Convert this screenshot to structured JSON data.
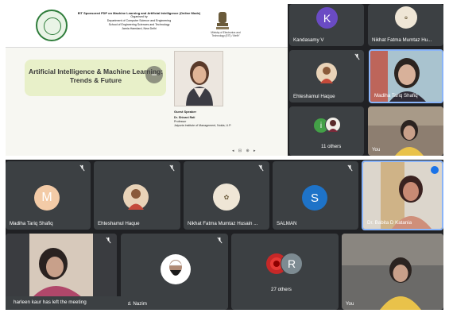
{
  "top_screenshot": {
    "slide": {
      "header_lines": [
        "EIT Sponsored FDP on Machine Learning and Artificial Intelligence (Online Mode)",
        "Organised by",
        "Department of Computer Science and Engineering",
        "School of Engineering Sciences and Technology",
        "Jamia Hamdard, New Delhi"
      ],
      "emblem_caption": "Ministry of Electronics and Technology (EIT) / MeitY",
      "title": "Artificial Intelligence & Machine Learning: Trends & Future",
      "speaker": {
        "heading": "Guest Speaker",
        "name": "Dr. Shivani Rati",
        "role": "Professor",
        "institute": "Jaipuria Institute of Management, Noida, U.P."
      },
      "controls": "◂ ⊟ ⊕ ▸"
    },
    "tiles": [
      {
        "name": "Kandasamy V",
        "initial": "K",
        "avatar_color": "#6a4bc4"
      },
      {
        "name": "Nikhat Fatma Mumtaz Hu...",
        "avatar_color": "#efe6d6"
      },
      {
        "name": "Ehteshamul Haque",
        "avatar_color": "#e9d3b8"
      },
      {
        "name": "Madiha Tariq Shafiq",
        "avatar_color": "#a2c6d6"
      },
      {
        "name": "11 others",
        "initial": "i",
        "avatar_color": "#43a047"
      },
      {
        "name": "You",
        "avatar_color": "#8a7b6a"
      }
    ]
  },
  "bottom_screenshot": {
    "tiles": [
      {
        "name": "Madiha Tariq Shafiq",
        "initial": "M",
        "avatar_color": "#f3cba7"
      },
      {
        "name": "Ehteshamul Haque",
        "avatar_color": "#e9d3b8"
      },
      {
        "name": "Nikhat Fatma Mumtaz Husain ...",
        "avatar_color": "#efe6d6"
      },
      {
        "name": "SALMAN",
        "initial": "S",
        "avatar_color": "#1e73c8"
      },
      {
        "name": "Dr. Babita D Katania",
        "avatar_color": "#c48a74"
      },
      {
        "name": "harleen kaur",
        "avatar_color": "#d9c8bb"
      },
      {
        "name": "hd. Nazim",
        "avatar_color": "#ffffff"
      },
      {
        "name": "27 others",
        "initial": "R",
        "avatar_color": "#7d8b92"
      },
      {
        "name": "You",
        "avatar_color": "#8a7b6a"
      }
    ],
    "toast": "harleen kaur has left the meeting"
  },
  "colors": {
    "meet_bg": "#202124",
    "tile_bg": "#3c4043",
    "active_speaker_border": "#8ab4f8",
    "slide_title_box": "#e8f0c9"
  },
  "icons": [
    "mic-off-icon",
    "more-options-icon"
  ]
}
